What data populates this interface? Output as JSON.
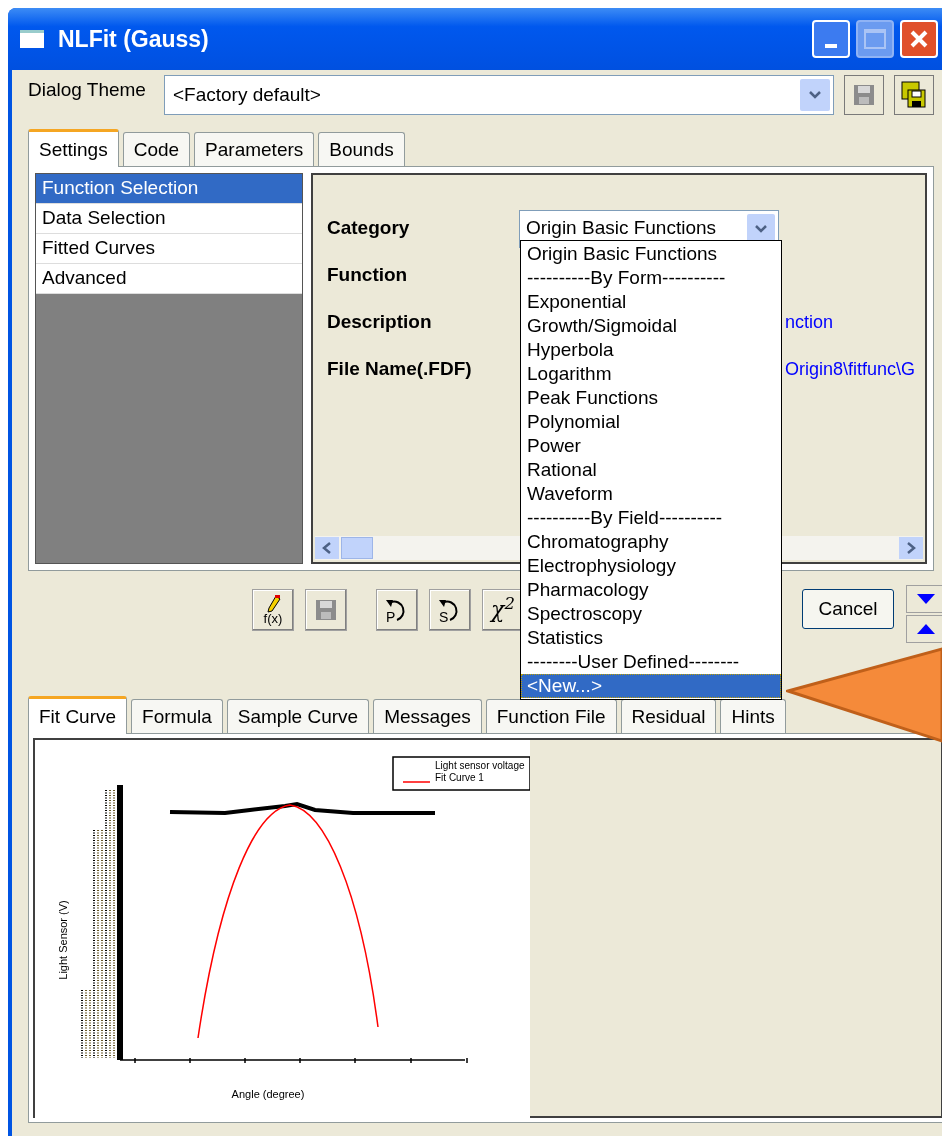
{
  "window": {
    "title": "NLFit (Gauss)"
  },
  "dialog_theme": {
    "label": "Dialog Theme",
    "value": "<Factory default>"
  },
  "top_tabs": [
    {
      "label": "Settings",
      "selected": true
    },
    {
      "label": "Code",
      "selected": false
    },
    {
      "label": "Parameters",
      "selected": false
    },
    {
      "label": "Bounds",
      "selected": false
    }
  ],
  "settings_list": [
    {
      "label": "Function Selection",
      "selected": true
    },
    {
      "label": "Data Selection",
      "selected": false
    },
    {
      "label": "Fitted Curves",
      "selected": false
    },
    {
      "label": "Advanced",
      "selected": false
    }
  ],
  "fields": [
    {
      "label": "Category"
    },
    {
      "label": "Function"
    },
    {
      "label": "Description",
      "value": "nction"
    },
    {
      "label": "File Name(.FDF)",
      "value": "Origin8\\fitfunc\\G"
    }
  ],
  "category_combo": {
    "value": "Origin Basic Functions"
  },
  "dropdown": [
    {
      "label": "Origin Basic Functions",
      "selected": false
    },
    {
      "label": "----------By Form----------",
      "selected": false
    },
    {
      "label": "Exponential",
      "selected": false
    },
    {
      "label": "Growth/Sigmoidal",
      "selected": false
    },
    {
      "label": "Hyperbola",
      "selected": false
    },
    {
      "label": "Logarithm",
      "selected": false
    },
    {
      "label": "Peak Functions",
      "selected": false
    },
    {
      "label": "Polynomial",
      "selected": false
    },
    {
      "label": "Power",
      "selected": false
    },
    {
      "label": "Rational",
      "selected": false
    },
    {
      "label": "Waveform",
      "selected": false
    },
    {
      "label": "----------By Field----------",
      "selected": false
    },
    {
      "label": "Chromatography",
      "selected": false
    },
    {
      "label": "Electrophysiology",
      "selected": false
    },
    {
      "label": "Pharmacology",
      "selected": false
    },
    {
      "label": "Spectroscopy",
      "selected": false
    },
    {
      "label": "Statistics",
      "selected": false
    },
    {
      "label": "--------User Defined--------",
      "selected": false
    },
    {
      "label": "<New...>",
      "selected": true
    }
  ],
  "toolbar": [
    {
      "kind": "fx",
      "label": "f(x)"
    },
    {
      "kind": "save"
    },
    {
      "kind": "undo",
      "label": "P"
    },
    {
      "kind": "undo",
      "label": "S"
    },
    {
      "kind": "chi",
      "label": "χ$^{2}$"
    }
  ],
  "cancel_button": "Cancel",
  "bottom_tabs": [
    {
      "label": "Fit Curve",
      "selected": true
    },
    {
      "label": "Formula",
      "selected": false
    },
    {
      "label": "Sample Curve",
      "selected": false
    },
    {
      "label": "Messages",
      "selected": false
    },
    {
      "label": "Function File",
      "selected": false
    },
    {
      "label": "Residual",
      "selected": false
    },
    {
      "label": "Hints",
      "selected": false
    }
  ],
  "plot": {
    "ylabel": "Light Sensor (V)",
    "xlabel": "Angle (degree)",
    "legend": [
      {
        "label": "Light sensor voltage",
        "kind": "scatter"
      },
      {
        "label": "Fit Curve 1",
        "kind": "line"
      }
    ]
  }
}
